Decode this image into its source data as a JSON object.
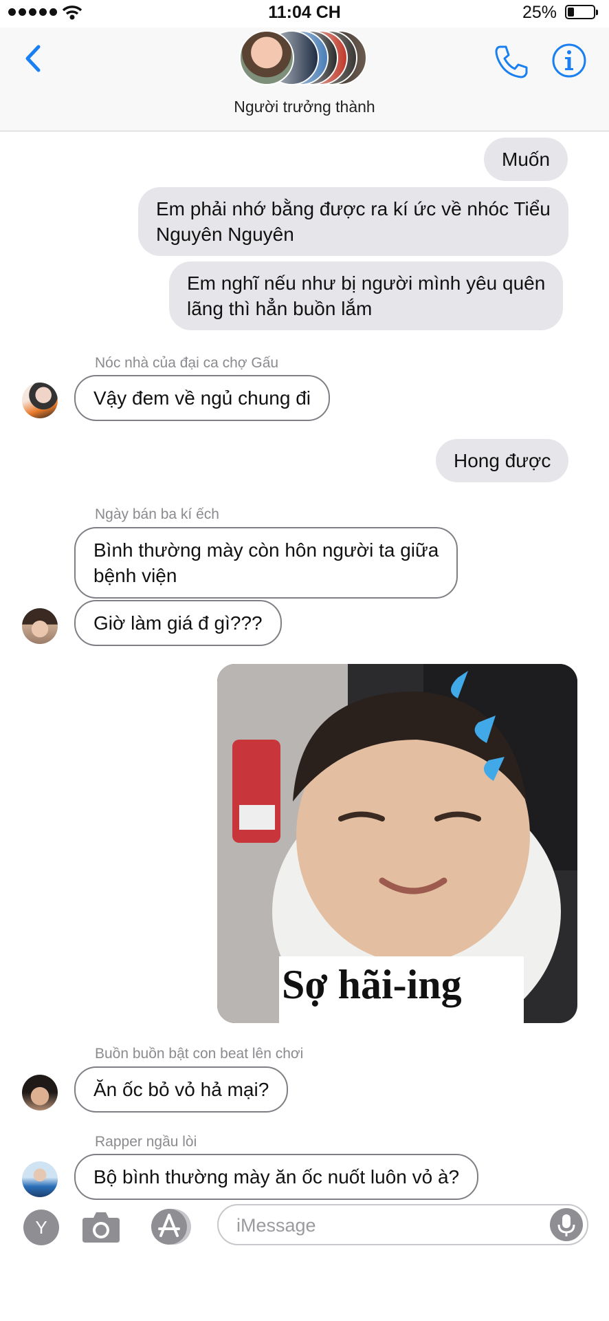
{
  "status_bar": {
    "time": "11:04 CH",
    "battery": "25%"
  },
  "header": {
    "title": "Người trưởng thành"
  },
  "messages": {
    "m1": "Muốn",
    "m2_line1": "Em phải nhớ bằng được ra kí ức về nhóc Tiểu",
    "m2_line2": "Nguyên Nguyên",
    "m3_line1": "Em nghĩ nếu như bị người mình yêu quên",
    "m3_line2": "lãng thì hẳn buồn lắm",
    "sender1": "Nóc nhà của đại ca chợ Gấu",
    "m4": "Vậy đem về ngủ chung đi",
    "m5": "Hong được",
    "sender2": "Ngày bán ba kí ếch",
    "m6_line1": "Bình thường mày còn hôn người ta giữa",
    "m6_line2": "bệnh viện",
    "m7": "Giờ làm giá đ gì???",
    "sticker_caption": "Sợ hãi-ing",
    "sender3": "Buồn buồn bật con beat lên chơi",
    "m8": "Ăn ốc bỏ vỏ hả mại?",
    "sender4": "Rapper ngầu lòi",
    "m9": "Bộ bình thường mày ăn ốc nuốt luôn vỏ à?"
  },
  "input_bar": {
    "placeholder": "iMessage",
    "memoji_letter": "Y"
  },
  "colors": {
    "accent": "#1a7ff0",
    "outgoing_bubble": "#e6e6ea",
    "incoming_border": "#7e7e84"
  },
  "icons": [
    "back-chevron-icon",
    "phone-icon",
    "info-icon",
    "camera-icon",
    "app-store-icon",
    "microphone-icon"
  ]
}
